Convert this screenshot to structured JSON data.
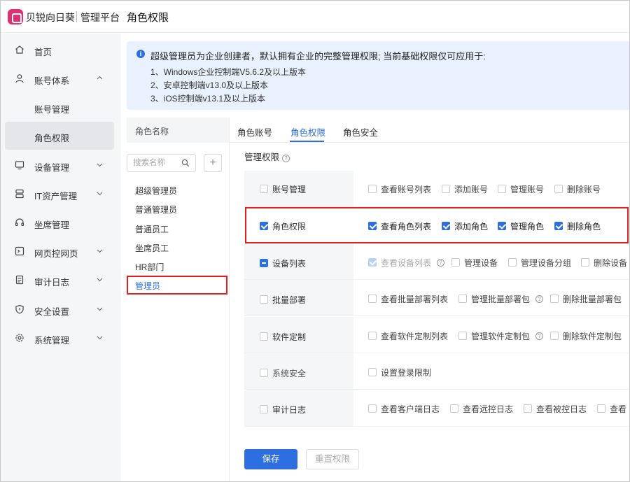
{
  "header": {
    "brand": "贝锐向日葵",
    "platform": "管理平台",
    "page_title": "角色权限"
  },
  "sidebar": {
    "items": [
      {
        "label": "首页",
        "icon": "home-icon"
      },
      {
        "label": "账号体系",
        "icon": "user-icon",
        "expanded": true
      },
      {
        "label": "账号管理"
      },
      {
        "label": "角色权限",
        "active": true
      },
      {
        "label": "设备管理",
        "icon": "monitor-icon"
      },
      {
        "label": "IT资产管理",
        "icon": "server-icon"
      },
      {
        "label": "坐席管理",
        "icon": "headset-icon"
      },
      {
        "label": "网页控网页",
        "icon": "webpage-icon"
      },
      {
        "label": "审计日志",
        "icon": "document-icon"
      },
      {
        "label": "安全设置",
        "icon": "shield-icon"
      },
      {
        "label": "系统管理",
        "icon": "gear-icon"
      }
    ]
  },
  "notice": {
    "headline": "超级管理员为企业创建者，默认拥有企业的完整管理权限; 当前基础权限仅可应用于:",
    "lines": [
      "1、Windows企业控制端V5.6.2及以上版本",
      "2、安卓控制端v13.0及以上版本",
      "3、iOS控制端v13.1及以上版本"
    ]
  },
  "roles": {
    "header": "角色名称",
    "search_placeholder": "搜索名称",
    "add_label": "+",
    "items": [
      "超级管理员",
      "普通管理员",
      "普通员工",
      "坐席员工",
      "HR部门",
      "管理员"
    ],
    "selected": "管理员"
  },
  "tabs": [
    "角色账号",
    "角色权限",
    "角色安全"
  ],
  "active_tab": "角色权限",
  "permissions": {
    "title": "管理权限",
    "rows": [
      {
        "category": "账号管理",
        "state": "unchecked",
        "options": [
          {
            "label": "查看账号列表",
            "state": "unchecked"
          },
          {
            "label": "添加账号",
            "state": "unchecked"
          },
          {
            "label": "管理账号",
            "state": "unchecked"
          },
          {
            "label": "删除账号",
            "state": "unchecked"
          }
        ]
      },
      {
        "category": "角色权限",
        "state": "checked",
        "options": [
          {
            "label": "查看角色列表",
            "state": "checked"
          },
          {
            "label": "添加角色",
            "state": "checked"
          },
          {
            "label": "管理角色",
            "state": "checked"
          },
          {
            "label": "删除角色",
            "state": "checked"
          }
        ]
      },
      {
        "category": "设备列表",
        "state": "indeterminate",
        "options": [
          {
            "label": "查看设备列表",
            "state": "disabled-checked",
            "help": true
          },
          {
            "label": "管理设备",
            "state": "unchecked"
          },
          {
            "label": "管理设备分组",
            "state": "unchecked"
          },
          {
            "label": "删除设备",
            "state": "unchecked"
          }
        ]
      },
      {
        "category": "批量部署",
        "state": "unchecked",
        "options": [
          {
            "label": "查看批量部署列表",
            "state": "unchecked"
          },
          {
            "label": "管理批量部署包",
            "state": "unchecked",
            "help": true
          },
          {
            "label": "删除批量部署包",
            "state": "unchecked"
          }
        ]
      },
      {
        "category": "软件定制",
        "state": "unchecked",
        "options": [
          {
            "label": "查看软件定制列表",
            "state": "unchecked"
          },
          {
            "label": "管理软件定制包",
            "state": "unchecked",
            "help": true
          },
          {
            "label": "删除软件定制包",
            "state": "unchecked"
          }
        ]
      },
      {
        "category": "系统安全",
        "state": "unchecked",
        "options": [
          {
            "label": "设置登录限制",
            "state": "unchecked"
          }
        ]
      },
      {
        "category": "审计日志",
        "state": "unchecked",
        "options": [
          {
            "label": "查看客户端日志",
            "state": "unchecked"
          },
          {
            "label": "查看远控日志",
            "state": "unchecked"
          },
          {
            "label": "查看被控日志",
            "state": "unchecked"
          },
          {
            "label": "查看",
            "state": "unchecked"
          }
        ]
      }
    ]
  },
  "buttons": {
    "save": "保存",
    "reset": "重置权限"
  },
  "colors": {
    "accent": "#2d6fe0",
    "highlight": "#e02020",
    "brand": "#e0306f",
    "notice_bg": "#e8f1fd"
  }
}
